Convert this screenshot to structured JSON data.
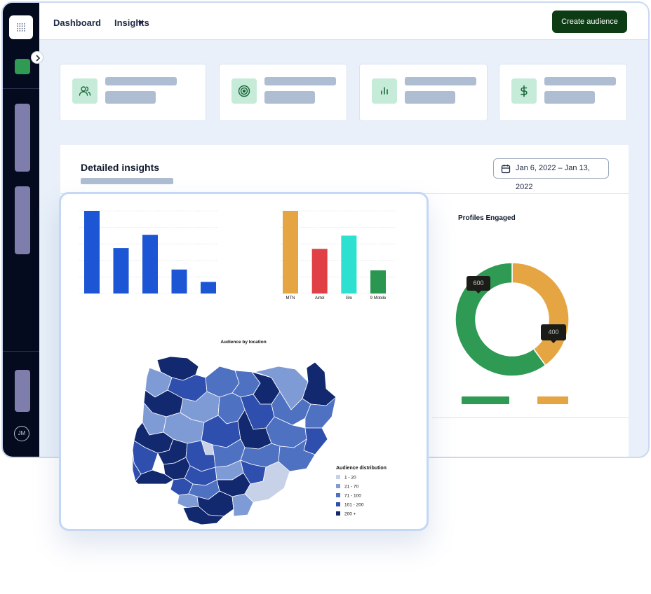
{
  "breadcrumb": {
    "root": "Dashboard",
    "current": "Insights"
  },
  "header": {
    "create_label": "Create audience"
  },
  "sidebar": {
    "avatar_initials": "JM"
  },
  "stat_cards": [
    {
      "icon": "users-icon"
    },
    {
      "icon": "target-icon"
    },
    {
      "icon": "bar-chart-icon"
    },
    {
      "icon": "dollar-icon"
    }
  ],
  "insights": {
    "title": "Detailed insights",
    "date_range": "Jan 6, 2022 – Jan 13, 2022"
  },
  "colors": {
    "accent_dark_green": "#0d3b14",
    "icon_bg": "#c6ecd9",
    "green": "#2e9a53",
    "orange": "#e5a542"
  },
  "chart_data": [
    {
      "type": "bar",
      "categories": [
        "",
        "",
        "",
        "",
        ""
      ],
      "values": [
        100,
        55,
        71,
        29,
        14
      ],
      "colors": [
        "#1c56d4"
      ]
    },
    {
      "type": "bar",
      "categories": [
        "MTN",
        "Airtel",
        "Glo",
        "9 Mobile"
      ],
      "values": [
        100,
        54,
        70,
        28
      ],
      "colors": [
        "#e5a542",
        "#df3f45",
        "#2ee0cf",
        "#2a9650"
      ]
    },
    {
      "type": "pie",
      "title": "Profiles Engaged",
      "donut": true,
      "slices": [
        {
          "label": "600",
          "value": 600,
          "color": "#2e9a53"
        },
        {
          "label": "400",
          "value": 400,
          "color": "#e5a542"
        }
      ]
    },
    {
      "type": "heatmap",
      "title": "Audience by location",
      "legend_title": "Audience distribution",
      "bins": [
        {
          "label": "1 - 20",
          "color": "#c7d1e8"
        },
        {
          "label": "21 - 70",
          "color": "#7f9bd6"
        },
        {
          "label": "71 - 100",
          "color": "#4e71c2"
        },
        {
          "label": "101 - 200",
          "color": "#2f4fae"
        },
        {
          "label": "200 +",
          "color": "#13296f"
        }
      ]
    }
  ]
}
